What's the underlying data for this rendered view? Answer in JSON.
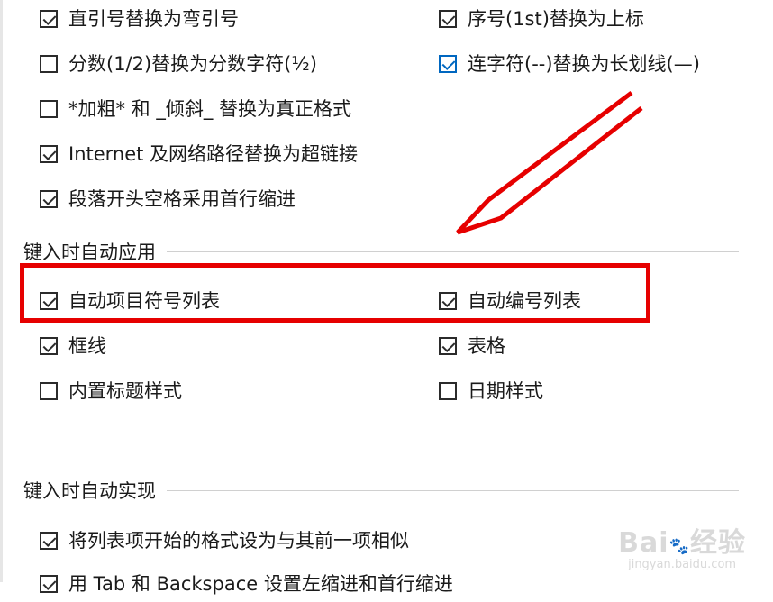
{
  "autoformat": {
    "row1_left": "直引号替换为弯引号",
    "row1_right": "序号(1st)替换为上标",
    "row2_left": "分数(1/2)替换为分数字符(½)",
    "row2_right": "连字符(--)替换为长划线(—)",
    "row3_left": "*加粗* 和 _倾斜_ 替换为真正格式",
    "row4_left": "Internet 及网络路径替换为超链接",
    "row5_left": "段落开头空格采用首行缩进"
  },
  "apply_section": {
    "title": "键入时自动应用",
    "bulleted": "自动项目符号列表",
    "numbered": "自动编号列表",
    "borders": "框线",
    "tables": "表格",
    "heading_styles": "内置标题样式",
    "date_styles": "日期样式"
  },
  "auto_section": {
    "title": "键入时自动实现",
    "format_list": "将列表项开始的格式设为与其前一项相似",
    "tab_backspace": "用 Tab 和 Backspace 设置左缩进和首行缩进"
  },
  "checked": {
    "row1_left": true,
    "row1_right": true,
    "row2_left": false,
    "row2_right": true,
    "row3_left": false,
    "row4_left": true,
    "row5_left": true,
    "bulleted": true,
    "numbered": true,
    "borders": true,
    "tables": true,
    "heading_styles": false,
    "date_styles": false,
    "format_list": true,
    "tab_backspace": true
  },
  "colors": {
    "highlight": "#e60000",
    "accent_checkbox": "#0067c0"
  },
  "watermark": {
    "brand": "Bai",
    "brand2": "经验",
    "site": "jingyan.baidu.com"
  }
}
